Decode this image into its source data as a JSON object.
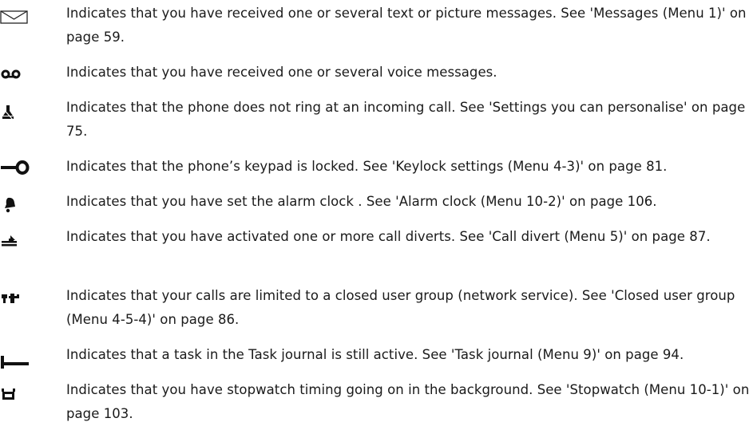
{
  "indicators": [
    {
      "icon": "envelope-icon",
      "text": "Indicates that you have received one or several text or picture messages. See 'Messages (Menu 1)' on page 59."
    },
    {
      "icon": "voicemail-icon",
      "text": "Indicates that you have received one or several voice messages."
    },
    {
      "icon": "silent-bell-icon",
      "text": "Indicates that the phone does not ring at an incoming call. See 'Settings you can personalise' on page 75."
    },
    {
      "icon": "key-icon",
      "text": "Indicates that the phone’s keypad is locked. See 'Keylock settings (Menu 4-3)' on page 81."
    },
    {
      "icon": "alarm-bell-icon",
      "text": "Indicates that you have set the alarm clock . See 'Alarm clock (Menu 10-2)' on page 106."
    },
    {
      "icon": "call-divert-icon",
      "text": "Indicates that you have activated one or more call diverts. See 'Call divert (Menu 5)' on page 87."
    },
    {
      "icon": "closed-user-group-icon",
      "text": "Indicates that your calls are limited to a closed user group (network service). See 'Closed user group (Menu 4-5-4)' on page 86."
    },
    {
      "icon": "task-journal-icon",
      "text": "Indicates that a task in the Task journal is still active. See 'Task journal (Menu 9)' on page 94."
    },
    {
      "icon": "stopwatch-icon",
      "text": "Indicates that you have stopwatch timing going on in the background. See 'Stopwatch (Menu 10-1)' on page 103."
    }
  ]
}
